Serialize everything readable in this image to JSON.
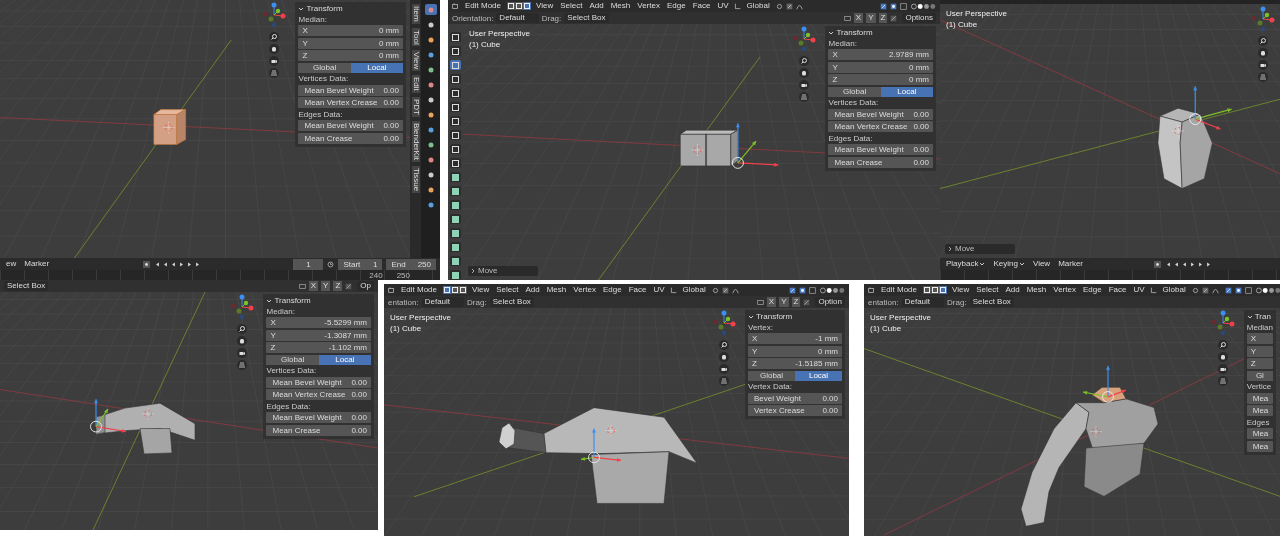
{
  "panels": [
    {
      "kind": "cube",
      "sidebar": {
        "title": "Transform",
        "section": "Median:",
        "fields": [
          {
            "axis": "X",
            "value": "0 mm"
          },
          {
            "axis": "Y",
            "value": "0 mm"
          },
          {
            "axis": "Z",
            "value": "0 mm"
          }
        ],
        "buttons": [
          {
            "label": "Global",
            "selected": false
          },
          {
            "label": "Local",
            "selected": true
          }
        ],
        "groups": [
          {
            "title": "Vertices Data:",
            "rows": [
              {
                "label": "Mean Bevel Weight",
                "value": "0.00"
              },
              {
                "label": "Mean Vertex Crease",
                "value": "0.00"
              }
            ]
          },
          {
            "title": "Edges Data:",
            "rows": [
              {
                "label": "Mean Bevel Weight",
                "value": "0.00"
              },
              {
                "label": "Mean Crease",
                "value": "0.00"
              }
            ]
          }
        ]
      },
      "tabs": [
        "Item",
        "Tool",
        "View",
        "Edit",
        "PDT",
        "BlenderKit",
        "Tissue"
      ],
      "properties_tabs": [
        {
          "selected": true
        },
        {
          "selected": false
        },
        {
          "selected": false
        },
        {
          "selected": false
        },
        {
          "selected": false
        },
        {
          "selected": false
        },
        {
          "selected": false
        },
        {
          "selected": false
        },
        {
          "selected": false
        },
        {
          "selected": false
        },
        {
          "selected": false
        },
        {
          "selected": false
        },
        {
          "selected": false
        },
        {
          "selected": false
        }
      ],
      "timeline": {
        "menus": [
          {
            "label": "ew",
            "dropdown": false
          },
          {
            "label": "Marker",
            "dropdown": false
          }
        ],
        "frame": "1",
        "start_label": "Start",
        "start": "1",
        "end_label": "End",
        "end": "250",
        "ruler": [
          "240",
          "250"
        ]
      }
    },
    {
      "kind": "box",
      "header": {
        "mode": "Edit Mode",
        "select_modes": [
          {
            "selected": false
          },
          {
            "selected": false
          },
          {
            "selected": true
          }
        ],
        "menus": [
          "View",
          "Select",
          "Add",
          "Mesh",
          "Vertex",
          "Edge",
          "Face",
          "UV"
        ],
        "orientation": "Global"
      },
      "tool_settings": {
        "orientation_label": "Orientation:",
        "orientation": "Default",
        "drag_label": "Drag:",
        "drag": "Select Box",
        "axes": [
          "X",
          "Y",
          "Z"
        ],
        "options": "Options"
      },
      "toolbar": [
        {
          "selected": false
        },
        {
          "selected": false
        },
        {
          "selected": true
        },
        {
          "selected": false
        },
        {
          "selected": false
        },
        {
          "selected": false
        },
        {
          "selected": false
        },
        {
          "selected": false
        },
        {
          "selected": false
        },
        {
          "selected": false
        },
        {
          "selected": false
        },
        {
          "selected": false
        },
        {
          "selected": false
        },
        {
          "selected": false
        },
        {
          "selected": false
        },
        {
          "selected": false
        },
        {
          "selected": false
        },
        {
          "selected": false
        }
      ],
      "view_label": {
        "perspective": "User Perspective",
        "object": "(1) Cube"
      },
      "sidebar": {
        "title": "Transform",
        "section": "Median:",
        "fields": [
          {
            "axis": "X",
            "value": "2.9789 mm"
          },
          {
            "axis": "Y",
            "value": "0 mm"
          },
          {
            "axis": "Z",
            "value": "0 mm"
          }
        ],
        "buttons": [
          {
            "label": "Global",
            "selected": false
          },
          {
            "label": "Local",
            "selected": true
          }
        ],
        "groups": [
          {
            "title": "Vertices Data:",
            "rows": [
              {
                "label": "Mean Bevel Weight",
                "value": "0.00"
              },
              {
                "label": "Mean Vertex Crease",
                "value": "0.00"
              }
            ]
          },
          {
            "title": "Edges Data:",
            "rows": [
              {
                "label": "Mean Bevel Weight",
                "value": "0.00"
              },
              {
                "label": "Mean Crease",
                "value": "0.00"
              }
            ]
          }
        ]
      },
      "operator": "Move"
    },
    {
      "kind": "tall",
      "view_label": {
        "perspective": "User Perspective",
        "object": "(1) Cube"
      },
      "operator": "Move",
      "timeline": {
        "menus": [
          {
            "label": "Playback",
            "dropdown": true
          },
          {
            "label": "Keying",
            "dropdown": true
          },
          {
            "label": "View",
            "dropdown": false
          },
          {
            "label": "Marker",
            "dropdown": false
          }
        ]
      }
    },
    {
      "kind": "wing",
      "tool_settings": {
        "drag": "Select Box",
        "axes": [
          "X",
          "Y",
          "Z"
        ],
        "options": "Op"
      },
      "sidebar": {
        "title": "Transform",
        "section": "Median:",
        "fields": [
          {
            "axis": "X",
            "value": "-5.5299 mm"
          },
          {
            "axis": "Y",
            "value": "-1.3087 mm"
          },
          {
            "axis": "Z",
            "value": "-1.102 mm"
          }
        ],
        "buttons": [
          {
            "label": "Global",
            "selected": false
          },
          {
            "label": "Local",
            "selected": true
          }
        ],
        "groups": [
          {
            "title": "Vertices Data:",
            "rows": [
              {
                "label": "Mean Bevel Weight",
                "value": "0.00"
              },
              {
                "label": "Mean Vertex Crease",
                "value": "0.00"
              }
            ]
          },
          {
            "title": "Edges Data:",
            "rows": [
              {
                "label": "Mean Bevel Weight",
                "value": "0.00"
              },
              {
                "label": "Mean Crease",
                "value": "0.00"
              }
            ]
          }
        ]
      }
    },
    {
      "kind": "trunk",
      "header": {
        "mode": "Edit Mode",
        "select_modes": [
          {
            "selected": true
          },
          {
            "selected": false
          },
          {
            "selected": false
          }
        ],
        "menus": [
          "View",
          "Select",
          "Add",
          "Mesh",
          "Vertex",
          "Edge",
          "Face",
          "UV"
        ],
        "orientation": "Global"
      },
      "tool_settings": {
        "orientation_label": "entation:",
        "orientation": "Default",
        "drag_label": "Drag:",
        "drag": "Select Box",
        "axes": [
          "X",
          "Y",
          "Z"
        ],
        "options": "Option"
      },
      "view_label": {
        "perspective": "User Perspective",
        "object": "(1) Cube"
      },
      "sidebar": {
        "title": "Transform",
        "section": "Vertex:",
        "fields": [
          {
            "axis": "X",
            "value": "-1 mm"
          },
          {
            "axis": "Y",
            "value": "0 mm"
          },
          {
            "axis": "Z",
            "value": "-1.5185 mm"
          }
        ],
        "buttons": [
          {
            "label": "Global",
            "selected": false
          },
          {
            "label": "Local",
            "selected": true
          }
        ],
        "groups": [
          {
            "title": "Vertex Data:",
            "rows": [
              {
                "label": "Bevel Weight",
                "value": "0.00"
              },
              {
                "label": "Vertex Crease",
                "value": "0.00"
              }
            ]
          }
        ]
      }
    },
    {
      "kind": "elephant",
      "header": {
        "mode": "Edit Mode",
        "select_modes": [
          {
            "selected": false
          },
          {
            "selected": false
          },
          {
            "selected": true
          }
        ],
        "menus": [
          "View",
          "Select",
          "Add",
          "Mesh",
          "Vertex",
          "Edge",
          "Face",
          "UV"
        ],
        "orientation": "Global"
      },
      "tool_settings": {
        "orientation_label": "entation:",
        "orientation": "Default",
        "drag_label": "Drag:",
        "drag": "Select Box"
      },
      "view_label": {
        "perspective": "User Perspective",
        "object": "(1) Cube"
      },
      "sidebar": {
        "title": "Tran",
        "section": "Median",
        "fields": [
          {
            "axis": "X"
          },
          {
            "axis": "Y"
          },
          {
            "axis": "Z"
          }
        ],
        "buttons": [
          {
            "label": "Gl",
            "selected": false
          }
        ],
        "groups": [
          {
            "title": "Vertice",
            "rows": [
              {
                "label": "Mea"
              },
              {
                "label": "Mea"
              }
            ]
          },
          {
            "title": "Edges",
            "rows": [
              {
                "label": "Mea"
              },
              {
                "label": "Mea"
              }
            ]
          }
        ]
      }
    }
  ]
}
